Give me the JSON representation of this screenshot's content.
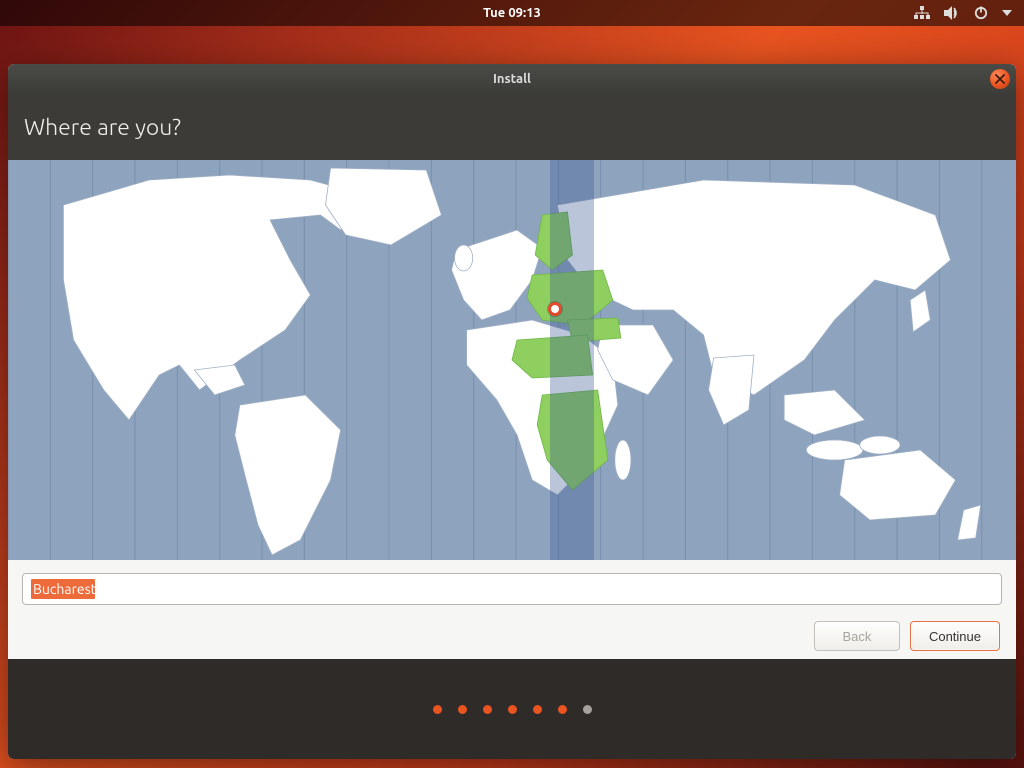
{
  "topbar": {
    "clock": "Tue 09:13"
  },
  "window": {
    "title": "Install"
  },
  "page": {
    "heading": "Where are you?",
    "timezone_input_value": "Bucharest"
  },
  "buttons": {
    "back": "Back",
    "continue": "Continue"
  },
  "progress": {
    "total": 7,
    "current": 7
  },
  "colors": {
    "accent": "#e95420",
    "panel": "#3c3b37",
    "map_water": "#8ea3bd",
    "map_land": "#ffffff",
    "map_highlight": "#8ecf5f"
  }
}
